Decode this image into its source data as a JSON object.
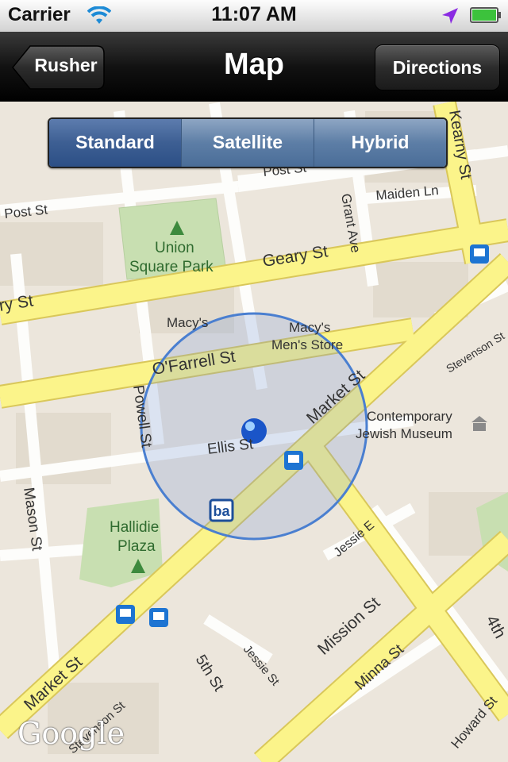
{
  "status_bar": {
    "carrier": "Carrier",
    "time": "11:07 AM"
  },
  "nav": {
    "back_label": "Rusher",
    "title": "Map",
    "right_label": "Directions"
  },
  "segments": [
    "Standard",
    "Satellite",
    "Hybrid"
  ],
  "segment_selected": "Standard",
  "map": {
    "labels": {
      "post_st_left": "Post St",
      "post_st_top": "Post St",
      "maiden_ln": "Maiden Ln",
      "grant_ave": "Grant Ave",
      "kearny_st": "Kearny St",
      "union_square_1": "Union",
      "union_square_2": "Square Park",
      "geary_st": "Geary St",
      "geary_st_left": "ry St",
      "macys": "Macy's",
      "macys_mens_1": "Macy's",
      "macys_mens_2": "Men's Store",
      "ofarrell_st": "O'Farrell St",
      "stevenson_st": "Stevenson St",
      "market_st_upper": "Market St",
      "powell_st": "Powell St",
      "ellis_st": "Ellis St",
      "cjm_1": "Contemporary",
      "cjm_2": "Jewish Museum",
      "mason_st": "Mason St",
      "hallidie_1": "Hallidie",
      "hallidie_2": "Plaza",
      "jessie_st_right": "Jessie E",
      "mission_st": "Mission St",
      "market_st_lower": "Market St",
      "fifth_st": "5th St",
      "jessie_st_lower": "Jessie St",
      "minna_st": "Minna St",
      "fourth_st": "4th",
      "howard_st": "Howard St",
      "stevenson_st_lower": "Stevenson St"
    },
    "attribution": "Google"
  }
}
